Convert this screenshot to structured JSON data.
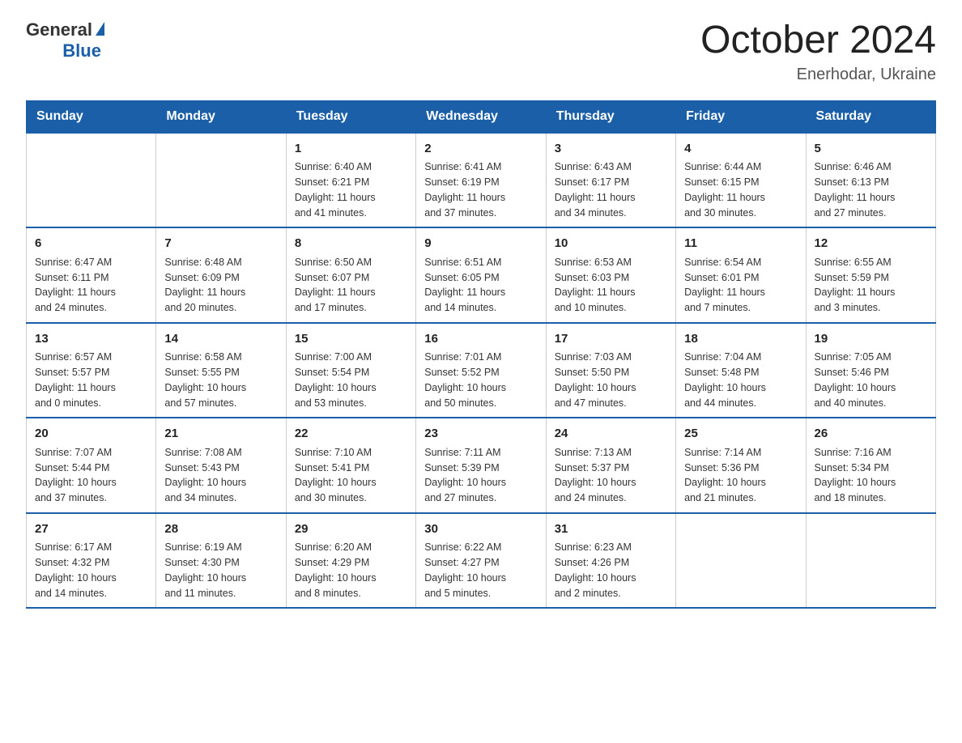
{
  "logo": {
    "text_general": "General",
    "text_blue": "Blue"
  },
  "header": {
    "month_title": "October 2024",
    "location": "Enerhodar, Ukraine"
  },
  "weekdays": [
    "Sunday",
    "Monday",
    "Tuesday",
    "Wednesday",
    "Thursday",
    "Friday",
    "Saturday"
  ],
  "weeks": [
    [
      {
        "day": "",
        "info": ""
      },
      {
        "day": "",
        "info": ""
      },
      {
        "day": "1",
        "info": "Sunrise: 6:40 AM\nSunset: 6:21 PM\nDaylight: 11 hours\nand 41 minutes."
      },
      {
        "day": "2",
        "info": "Sunrise: 6:41 AM\nSunset: 6:19 PM\nDaylight: 11 hours\nand 37 minutes."
      },
      {
        "day": "3",
        "info": "Sunrise: 6:43 AM\nSunset: 6:17 PM\nDaylight: 11 hours\nand 34 minutes."
      },
      {
        "day": "4",
        "info": "Sunrise: 6:44 AM\nSunset: 6:15 PM\nDaylight: 11 hours\nand 30 minutes."
      },
      {
        "day": "5",
        "info": "Sunrise: 6:46 AM\nSunset: 6:13 PM\nDaylight: 11 hours\nand 27 minutes."
      }
    ],
    [
      {
        "day": "6",
        "info": "Sunrise: 6:47 AM\nSunset: 6:11 PM\nDaylight: 11 hours\nand 24 minutes."
      },
      {
        "day": "7",
        "info": "Sunrise: 6:48 AM\nSunset: 6:09 PM\nDaylight: 11 hours\nand 20 minutes."
      },
      {
        "day": "8",
        "info": "Sunrise: 6:50 AM\nSunset: 6:07 PM\nDaylight: 11 hours\nand 17 minutes."
      },
      {
        "day": "9",
        "info": "Sunrise: 6:51 AM\nSunset: 6:05 PM\nDaylight: 11 hours\nand 14 minutes."
      },
      {
        "day": "10",
        "info": "Sunrise: 6:53 AM\nSunset: 6:03 PM\nDaylight: 11 hours\nand 10 minutes."
      },
      {
        "day": "11",
        "info": "Sunrise: 6:54 AM\nSunset: 6:01 PM\nDaylight: 11 hours\nand 7 minutes."
      },
      {
        "day": "12",
        "info": "Sunrise: 6:55 AM\nSunset: 5:59 PM\nDaylight: 11 hours\nand 3 minutes."
      }
    ],
    [
      {
        "day": "13",
        "info": "Sunrise: 6:57 AM\nSunset: 5:57 PM\nDaylight: 11 hours\nand 0 minutes."
      },
      {
        "day": "14",
        "info": "Sunrise: 6:58 AM\nSunset: 5:55 PM\nDaylight: 10 hours\nand 57 minutes."
      },
      {
        "day": "15",
        "info": "Sunrise: 7:00 AM\nSunset: 5:54 PM\nDaylight: 10 hours\nand 53 minutes."
      },
      {
        "day": "16",
        "info": "Sunrise: 7:01 AM\nSunset: 5:52 PM\nDaylight: 10 hours\nand 50 minutes."
      },
      {
        "day": "17",
        "info": "Sunrise: 7:03 AM\nSunset: 5:50 PM\nDaylight: 10 hours\nand 47 minutes."
      },
      {
        "day": "18",
        "info": "Sunrise: 7:04 AM\nSunset: 5:48 PM\nDaylight: 10 hours\nand 44 minutes."
      },
      {
        "day": "19",
        "info": "Sunrise: 7:05 AM\nSunset: 5:46 PM\nDaylight: 10 hours\nand 40 minutes."
      }
    ],
    [
      {
        "day": "20",
        "info": "Sunrise: 7:07 AM\nSunset: 5:44 PM\nDaylight: 10 hours\nand 37 minutes."
      },
      {
        "day": "21",
        "info": "Sunrise: 7:08 AM\nSunset: 5:43 PM\nDaylight: 10 hours\nand 34 minutes."
      },
      {
        "day": "22",
        "info": "Sunrise: 7:10 AM\nSunset: 5:41 PM\nDaylight: 10 hours\nand 30 minutes."
      },
      {
        "day": "23",
        "info": "Sunrise: 7:11 AM\nSunset: 5:39 PM\nDaylight: 10 hours\nand 27 minutes."
      },
      {
        "day": "24",
        "info": "Sunrise: 7:13 AM\nSunset: 5:37 PM\nDaylight: 10 hours\nand 24 minutes."
      },
      {
        "day": "25",
        "info": "Sunrise: 7:14 AM\nSunset: 5:36 PM\nDaylight: 10 hours\nand 21 minutes."
      },
      {
        "day": "26",
        "info": "Sunrise: 7:16 AM\nSunset: 5:34 PM\nDaylight: 10 hours\nand 18 minutes."
      }
    ],
    [
      {
        "day": "27",
        "info": "Sunrise: 6:17 AM\nSunset: 4:32 PM\nDaylight: 10 hours\nand 14 minutes."
      },
      {
        "day": "28",
        "info": "Sunrise: 6:19 AM\nSunset: 4:30 PM\nDaylight: 10 hours\nand 11 minutes."
      },
      {
        "day": "29",
        "info": "Sunrise: 6:20 AM\nSunset: 4:29 PM\nDaylight: 10 hours\nand 8 minutes."
      },
      {
        "day": "30",
        "info": "Sunrise: 6:22 AM\nSunset: 4:27 PM\nDaylight: 10 hours\nand 5 minutes."
      },
      {
        "day": "31",
        "info": "Sunrise: 6:23 AM\nSunset: 4:26 PM\nDaylight: 10 hours\nand 2 minutes."
      },
      {
        "day": "",
        "info": ""
      },
      {
        "day": "",
        "info": ""
      }
    ]
  ]
}
